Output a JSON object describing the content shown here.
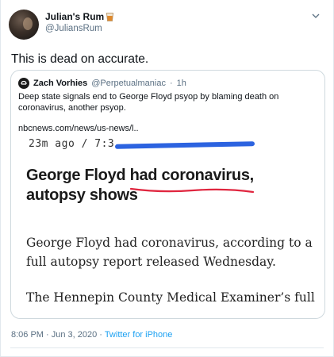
{
  "author": {
    "name": "Julian's Rum",
    "handle": "@JuliansRum",
    "name_icon": "rum-glass-emoji"
  },
  "tweet": {
    "text": "This is dead on accurate."
  },
  "quoted_tweet": {
    "name": "Zach Vorhies",
    "handle": "@Perpetualmaniac",
    "separator": "·",
    "time": "1h",
    "text": "Deep state signals end to George Floyd psyop by blaming death on coronavirus, another psyop.",
    "link": "nbcnews.com/news/us-news/l..",
    "article": {
      "timestamp": "23m ago / 7:3",
      "headline": "George Floyd had coronavirus, autopsy shows",
      "paragraph_1": "George Floyd had coronavirus, according to a full autopsy report released Wednesday.",
      "paragraph_2": "The Hennepin County Medical Examiner’s full"
    }
  },
  "footer": {
    "timestamp": "8:06 PM · Jun 3, 2020",
    "separator": " · ",
    "source": "Twitter for iPhone"
  },
  "colors": {
    "link_blue": "#1da1f2",
    "muted": "#5b7083",
    "highlight_red": "#e0263f",
    "highlight_blue": "#2c63e0"
  }
}
